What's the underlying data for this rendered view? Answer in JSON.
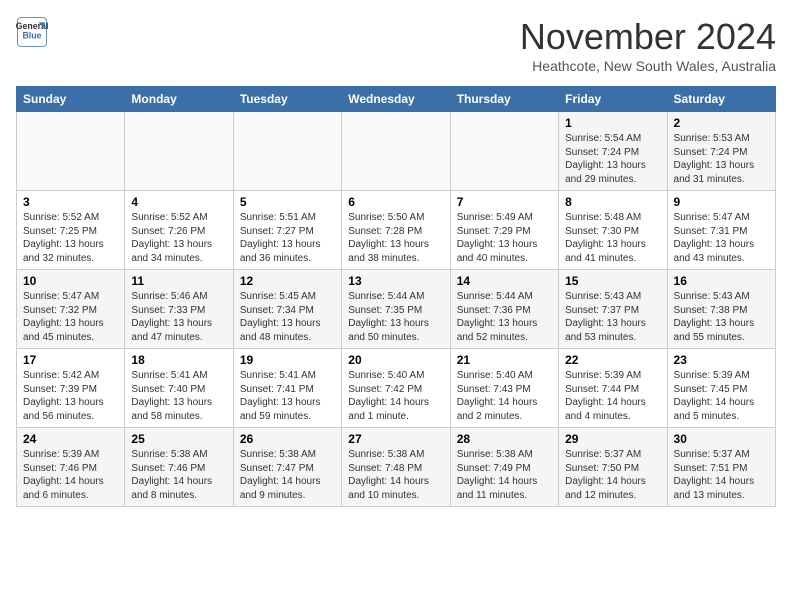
{
  "logo": {
    "line1": "General",
    "line2": "Blue"
  },
  "title": "November 2024",
  "location": "Heathcote, New South Wales, Australia",
  "days_of_week": [
    "Sunday",
    "Monday",
    "Tuesday",
    "Wednesday",
    "Thursday",
    "Friday",
    "Saturday"
  ],
  "weeks": [
    [
      {
        "day": "",
        "info": ""
      },
      {
        "day": "",
        "info": ""
      },
      {
        "day": "",
        "info": ""
      },
      {
        "day": "",
        "info": ""
      },
      {
        "day": "",
        "info": ""
      },
      {
        "day": "1",
        "info": "Sunrise: 5:54 AM\nSunset: 7:24 PM\nDaylight: 13 hours\nand 29 minutes."
      },
      {
        "day": "2",
        "info": "Sunrise: 5:53 AM\nSunset: 7:24 PM\nDaylight: 13 hours\nand 31 minutes."
      }
    ],
    [
      {
        "day": "3",
        "info": "Sunrise: 5:52 AM\nSunset: 7:25 PM\nDaylight: 13 hours\nand 32 minutes."
      },
      {
        "day": "4",
        "info": "Sunrise: 5:52 AM\nSunset: 7:26 PM\nDaylight: 13 hours\nand 34 minutes."
      },
      {
        "day": "5",
        "info": "Sunrise: 5:51 AM\nSunset: 7:27 PM\nDaylight: 13 hours\nand 36 minutes."
      },
      {
        "day": "6",
        "info": "Sunrise: 5:50 AM\nSunset: 7:28 PM\nDaylight: 13 hours\nand 38 minutes."
      },
      {
        "day": "7",
        "info": "Sunrise: 5:49 AM\nSunset: 7:29 PM\nDaylight: 13 hours\nand 40 minutes."
      },
      {
        "day": "8",
        "info": "Sunrise: 5:48 AM\nSunset: 7:30 PM\nDaylight: 13 hours\nand 41 minutes."
      },
      {
        "day": "9",
        "info": "Sunrise: 5:47 AM\nSunset: 7:31 PM\nDaylight: 13 hours\nand 43 minutes."
      }
    ],
    [
      {
        "day": "10",
        "info": "Sunrise: 5:47 AM\nSunset: 7:32 PM\nDaylight: 13 hours\nand 45 minutes."
      },
      {
        "day": "11",
        "info": "Sunrise: 5:46 AM\nSunset: 7:33 PM\nDaylight: 13 hours\nand 47 minutes."
      },
      {
        "day": "12",
        "info": "Sunrise: 5:45 AM\nSunset: 7:34 PM\nDaylight: 13 hours\nand 48 minutes."
      },
      {
        "day": "13",
        "info": "Sunrise: 5:44 AM\nSunset: 7:35 PM\nDaylight: 13 hours\nand 50 minutes."
      },
      {
        "day": "14",
        "info": "Sunrise: 5:44 AM\nSunset: 7:36 PM\nDaylight: 13 hours\nand 52 minutes."
      },
      {
        "day": "15",
        "info": "Sunrise: 5:43 AM\nSunset: 7:37 PM\nDaylight: 13 hours\nand 53 minutes."
      },
      {
        "day": "16",
        "info": "Sunrise: 5:43 AM\nSunset: 7:38 PM\nDaylight: 13 hours\nand 55 minutes."
      }
    ],
    [
      {
        "day": "17",
        "info": "Sunrise: 5:42 AM\nSunset: 7:39 PM\nDaylight: 13 hours\nand 56 minutes."
      },
      {
        "day": "18",
        "info": "Sunrise: 5:41 AM\nSunset: 7:40 PM\nDaylight: 13 hours\nand 58 minutes."
      },
      {
        "day": "19",
        "info": "Sunrise: 5:41 AM\nSunset: 7:41 PM\nDaylight: 13 hours\nand 59 minutes."
      },
      {
        "day": "20",
        "info": "Sunrise: 5:40 AM\nSunset: 7:42 PM\nDaylight: 14 hours\nand 1 minute."
      },
      {
        "day": "21",
        "info": "Sunrise: 5:40 AM\nSunset: 7:43 PM\nDaylight: 14 hours\nand 2 minutes."
      },
      {
        "day": "22",
        "info": "Sunrise: 5:39 AM\nSunset: 7:44 PM\nDaylight: 14 hours\nand 4 minutes."
      },
      {
        "day": "23",
        "info": "Sunrise: 5:39 AM\nSunset: 7:45 PM\nDaylight: 14 hours\nand 5 minutes."
      }
    ],
    [
      {
        "day": "24",
        "info": "Sunrise: 5:39 AM\nSunset: 7:46 PM\nDaylight: 14 hours\nand 6 minutes."
      },
      {
        "day": "25",
        "info": "Sunrise: 5:38 AM\nSunset: 7:46 PM\nDaylight: 14 hours\nand 8 minutes."
      },
      {
        "day": "26",
        "info": "Sunrise: 5:38 AM\nSunset: 7:47 PM\nDaylight: 14 hours\nand 9 minutes."
      },
      {
        "day": "27",
        "info": "Sunrise: 5:38 AM\nSunset: 7:48 PM\nDaylight: 14 hours\nand 10 minutes."
      },
      {
        "day": "28",
        "info": "Sunrise: 5:38 AM\nSunset: 7:49 PM\nDaylight: 14 hours\nand 11 minutes."
      },
      {
        "day": "29",
        "info": "Sunrise: 5:37 AM\nSunset: 7:50 PM\nDaylight: 14 hours\nand 12 minutes."
      },
      {
        "day": "30",
        "info": "Sunrise: 5:37 AM\nSunset: 7:51 PM\nDaylight: 14 hours\nand 13 minutes."
      }
    ]
  ]
}
